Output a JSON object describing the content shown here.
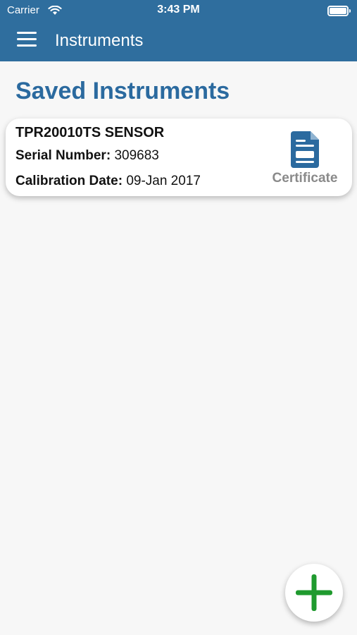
{
  "status_bar": {
    "carrier": "Carrier",
    "time": "3:43 PM",
    "wifi_icon": "wifi-icon",
    "battery_icon": "battery-icon"
  },
  "nav": {
    "menu_icon": "hamburger-menu-icon",
    "title": "Instruments"
  },
  "page": {
    "title": "Saved Instruments"
  },
  "instruments": [
    {
      "name": "TPR20010TS SENSOR",
      "serial_label": "Serial Number:",
      "serial_value": "309683",
      "calibration_label": "Calibration Date:",
      "calibration_value": "09-Jan 2017",
      "certificate_icon": "document-icon",
      "certificate_label": "Certificate"
    }
  ],
  "fab": {
    "icon": "plus-icon"
  },
  "colors": {
    "nav_background": "#2f6e9e",
    "title_blue": "#2b6a9f",
    "certificate_icon": "#2b6a9f",
    "certificate_label": "#8a8a8a",
    "fab_plus": "#1f9a2e",
    "background": "#f7f7f7"
  }
}
